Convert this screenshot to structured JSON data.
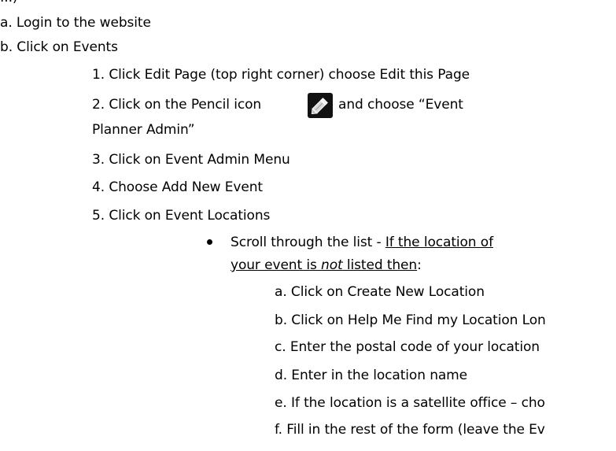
{
  "doc": {
    "top_partial": "...)",
    "steps": {
      "a": "a. Login to the website",
      "b": "b. Click on Events"
    },
    "substeps": {
      "s1": "1. Click Edit Page (top right corner) choose Edit this Page",
      "s2_pre": "2. Click on the Pencil icon",
      "s2_post": "and choose “Event",
      "s2_cont": "Planner Admin”",
      "s3": "3. Click on Event Admin Menu",
      "s4": "4. Choose Add New Event",
      "s5": "5. Click on Event Locations"
    },
    "bullet": {
      "pre": "Scroll through the list - ",
      "underline1": "If the location of",
      "underline2_a": "your event is ",
      "underline2_b": "not",
      "underline2_c": " listed then",
      "colon": ":"
    },
    "sub_sub": {
      "a": "a. Click on Create New Location",
      "b": "b. Click on Help Me Find my Location Lon",
      "c": "c. Enter the postal code of your location",
      "d": "d. Enter in the location name",
      "e": "e. If the location is a satellite office – cho",
      "f": "f. Fill in the rest of the form (leave the Ev"
    },
    "icon": "pencil-icon"
  }
}
